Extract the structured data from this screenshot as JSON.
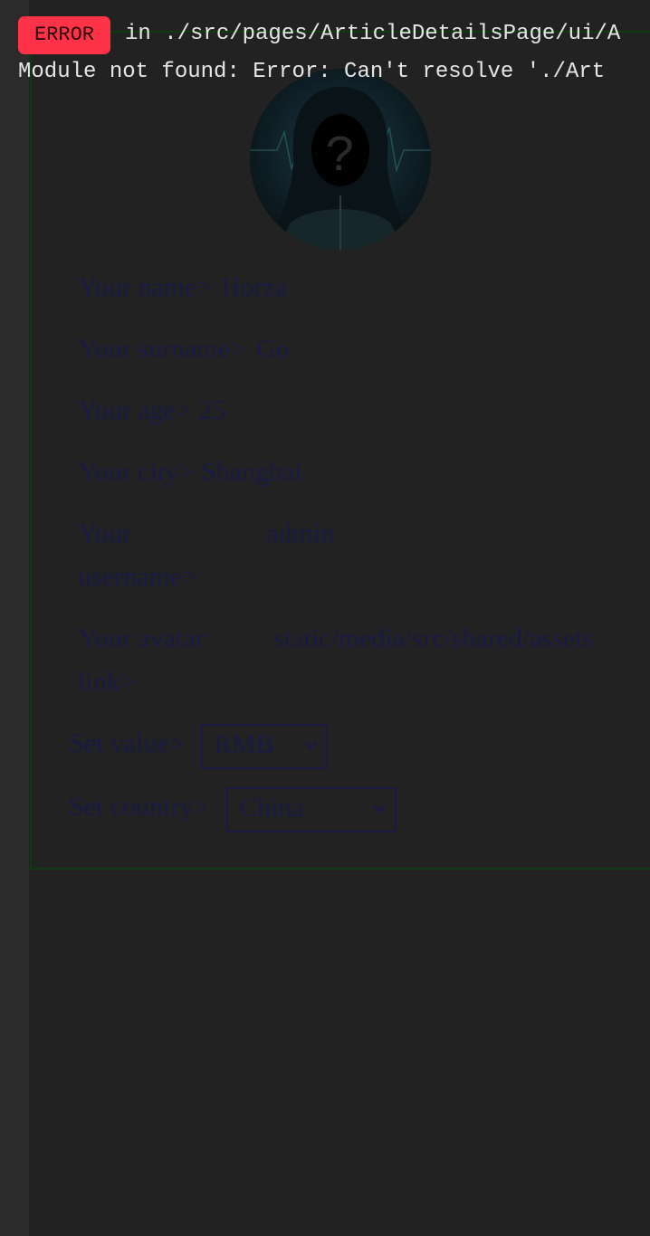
{
  "error": {
    "badge": "ERROR",
    "location": "in ./src/pages/ArticleDetailsPage/ui/A",
    "message": "Module not found: Error: Can't resolve './Art"
  },
  "profile": {
    "fields": [
      {
        "label": "Your name>",
        "value": "Horza"
      },
      {
        "label": "Your surname>",
        "value": "Go"
      },
      {
        "label": "Your age>",
        "value": "25"
      },
      {
        "label": "Your city>",
        "value": "Shanghai"
      },
      {
        "label": "Your username>",
        "value": "admin"
      },
      {
        "label": "Your avatar link>",
        "value": "static/media/src/shared/assets"
      }
    ],
    "currency": {
      "label": "Set value>",
      "selected": "RMB"
    },
    "country": {
      "label": "Set country>",
      "selected": "China"
    }
  },
  "colors": {
    "error_badge": "#ff3348",
    "card_border": "#0c3b0c",
    "field_text": "#1a1a44",
    "background": "#222222"
  }
}
